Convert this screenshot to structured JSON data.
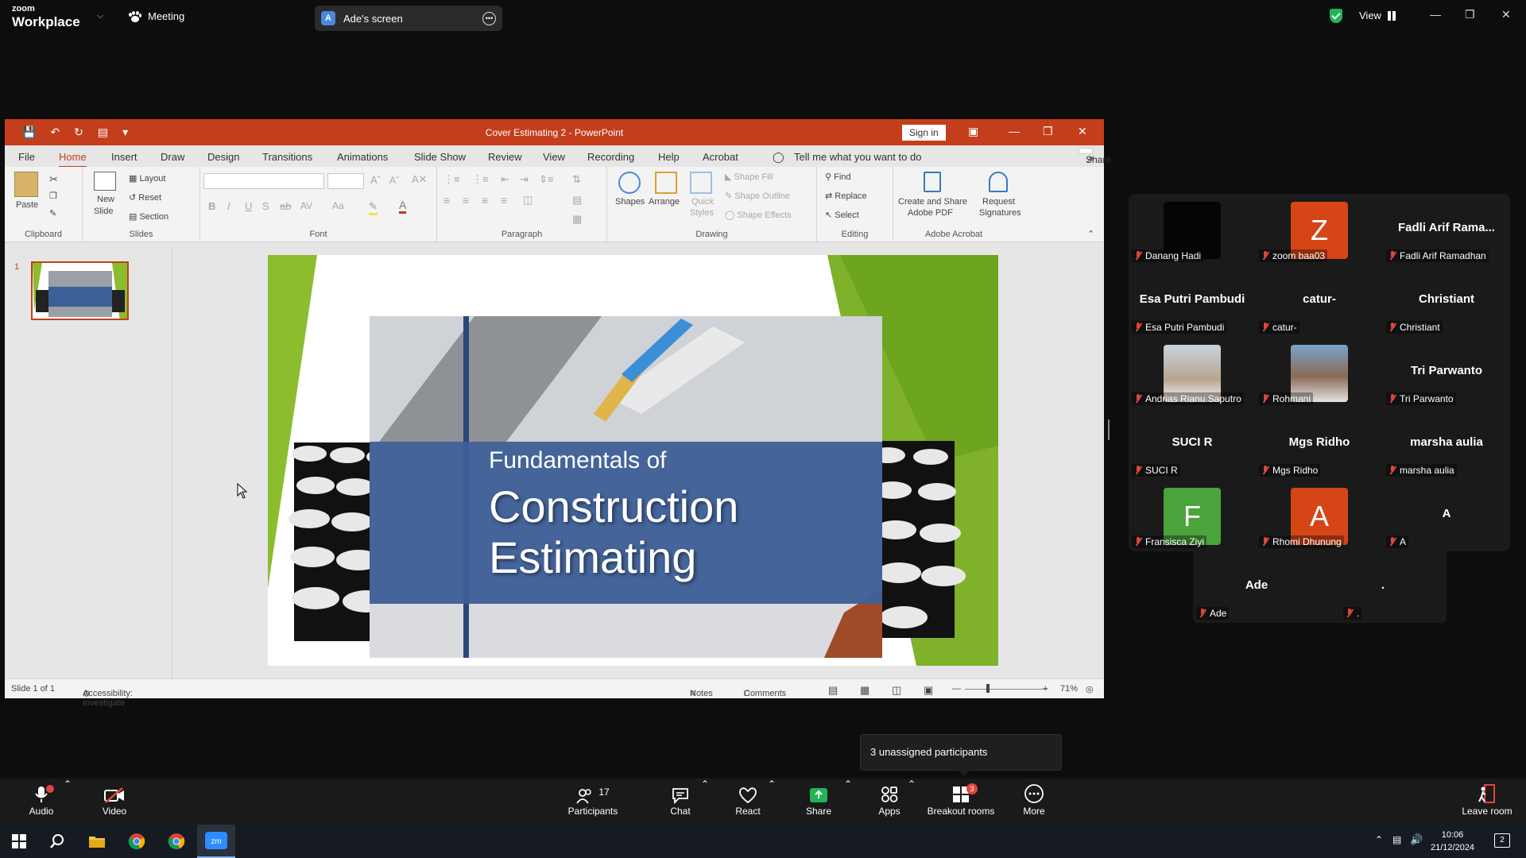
{
  "zoom": {
    "brand_line1": "zoom",
    "brand_line2": "Workplace",
    "meeting_label": "Meeting",
    "screen_share_label": "Ade's screen",
    "screen_share_avatar": "A",
    "view_label": "View",
    "accent_green": "#21b459"
  },
  "ppt": {
    "title": "Cover Estimating 2  -  PowerPoint",
    "sign_in": "Sign in",
    "menu": [
      "File",
      "Home",
      "Insert",
      "Draw",
      "Design",
      "Transitions",
      "Animations",
      "Slide Show",
      "Review",
      "View",
      "Recording",
      "Help",
      "Acrobat"
    ],
    "tell_me": "Tell me what you want to do",
    "share": "Share",
    "ribbon": {
      "clipboard": {
        "label": "Clipboard",
        "paste": "Paste"
      },
      "slides": {
        "label": "Slides",
        "new_slide_1": "New",
        "new_slide_2": "Slide",
        "layout": "Layout",
        "reset": "Reset",
        "section": "Section"
      },
      "font": {
        "label": "Font"
      },
      "paragraph": {
        "label": "Paragraph"
      },
      "drawing": {
        "label": "Drawing",
        "shapes": "Shapes",
        "arrange": "Arrange",
        "quick_1": "Quick",
        "quick_2": "Styles",
        "shape_fill": "Shape Fill",
        "shape_outline": "Shape Outline",
        "shape_effects": "Shape Effects"
      },
      "editing": {
        "label": "Editing",
        "find": "Find",
        "replace": "Replace",
        "select": "Select"
      },
      "acrobat": {
        "label": "Adobe Acrobat",
        "create_1": "Create and Share",
        "create_2": "Adobe PDF",
        "request_1": "Request",
        "request_2": "Signatures"
      }
    },
    "thumb_number": "1",
    "slide": {
      "line1": "Fundamentals of",
      "line2": "Construction",
      "line3": "Estimating"
    },
    "status": {
      "slide_count": "Slide 1 of 1",
      "accessibility": "Accessibility: Investigate",
      "notes": "Notes",
      "comments": "Comments",
      "zoom": "71%"
    },
    "brand_color": "#c43e1c"
  },
  "participants": [
    {
      "tile_text": "",
      "name": "Danang Hadi",
      "avatar": "video-black"
    },
    {
      "tile_text": "Z",
      "name": "zoom baa03",
      "avatar": "letter",
      "color": "#d64516"
    },
    {
      "tile_text": "Fadli Arif Rama...",
      "name": "Fadli Arif Ramadhan",
      "avatar": "name"
    },
    {
      "tile_text": "Esa Putri Pambudi",
      "name": "Esa Putri Pambudi",
      "avatar": "name"
    },
    {
      "tile_text": "catur-",
      "name": "catur-",
      "avatar": "name"
    },
    {
      "tile_text": "Christiant",
      "name": "Christiant",
      "avatar": "name"
    },
    {
      "tile_text": "",
      "name": "Andrias Rianu Saputro",
      "avatar": "photo"
    },
    {
      "tile_text": "",
      "name": "Rohmani",
      "avatar": "photo"
    },
    {
      "tile_text": "Tri Parwanto",
      "name": "Tri Parwanto",
      "avatar": "name"
    },
    {
      "tile_text": "SUCI R",
      "name": "SUCI R",
      "avatar": "name"
    },
    {
      "tile_text": "Mgs Ridho",
      "name": "Mgs Ridho",
      "avatar": "name"
    },
    {
      "tile_text": "marsha aulia",
      "name": "marsha aulia",
      "avatar": "name"
    },
    {
      "tile_text": "F",
      "name": "Fransisca Ziyi",
      "avatar": "letter",
      "color": "#4aa33b"
    },
    {
      "tile_text": "A",
      "name": "Rhomi Dhunung",
      "avatar": "letter",
      "color": "#d64516"
    },
    {
      "tile_text": "A",
      "name": "A",
      "avatar": "name"
    },
    {
      "tile_text": "Ade",
      "name": "Ade",
      "avatar": "name"
    },
    {
      "tile_text": ".",
      "name": ".",
      "avatar": "name"
    }
  ],
  "toast": "3 unassigned participants",
  "toolbar": {
    "audio": "Audio",
    "video": "Video",
    "participants": "Participants",
    "participants_count": "17",
    "chat": "Chat",
    "react": "React",
    "share": "Share",
    "apps": "Apps",
    "breakout": "Breakout rooms",
    "breakout_badge": "3",
    "more": "More",
    "leave": "Leave room"
  },
  "taskbar": {
    "time": "10:06",
    "date": "21/12/2024",
    "notif_count": "2"
  }
}
